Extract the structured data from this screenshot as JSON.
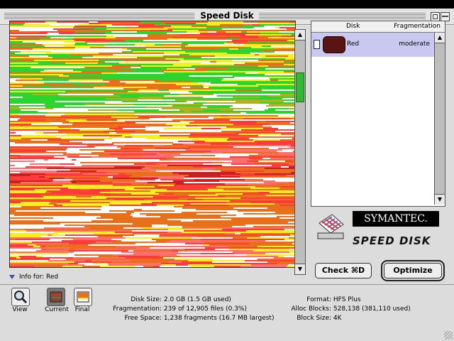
{
  "window": {
    "title": "Speed Disk"
  },
  "disk_list": {
    "columns": [
      "Disk",
      "Fragmentation"
    ],
    "rows": [
      {
        "disk": "Red",
        "fragmentation": "moderate"
      }
    ]
  },
  "branding": {
    "company": "SYMANTEC.",
    "product": "SPEED DISK"
  },
  "buttons": {
    "check": "Check ⌘D",
    "optimize": "Optimize"
  },
  "info_for": {
    "label": "Info for:",
    "disk": "Red"
  },
  "view_buttons": [
    {
      "label": "View",
      "icon": "magnifier-icon"
    },
    {
      "label": "Current",
      "icon": "current-map-icon"
    },
    {
      "label": "Final",
      "icon": "final-map-icon"
    }
  ],
  "stats_left": [
    {
      "key": "Disk Size",
      "value": "2.0 GB (1.5 GB used)"
    },
    {
      "key": "Fragmentation",
      "value": "239 of 12,905 files (0.3%)"
    },
    {
      "key": "Free Space",
      "value": "1,238 fragments (16.7 MB largest)"
    }
  ],
  "stats_right": [
    {
      "key": "Format",
      "value": "HFS Plus"
    },
    {
      "key": "Alloc Blocks",
      "value": "528,138 (381,110 used)"
    },
    {
      "key": "Block Size",
      "value": "4K"
    }
  ],
  "colors": {
    "orange": "#e8701a",
    "red": "#ff3a3a",
    "green": "#2ed42e",
    "yellow": "#f4f020",
    "white": "#ffffff",
    "pink": "#ff6f6f",
    "darkred": "#c82020",
    "olive": "#b0b020",
    "selection": "#c8c8f0",
    "scroll_thumb": "#35b735"
  }
}
